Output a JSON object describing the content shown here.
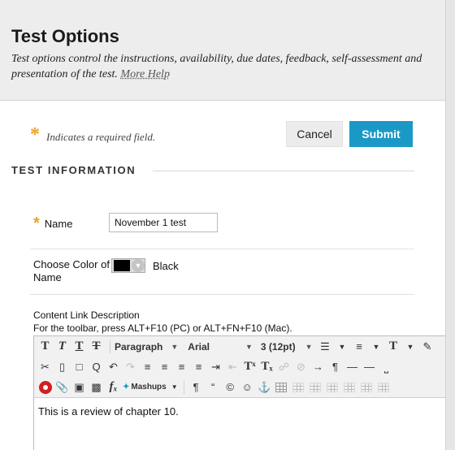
{
  "header": {
    "title": "Test Options",
    "description": "Test options control the instructions, availability, due dates, feedback, self-assessment and presentation of the test.",
    "help_link": "More Help"
  },
  "required_note": {
    "star": "*",
    "text": "Indicates a required field."
  },
  "actions": {
    "cancel_label": "Cancel",
    "submit_label": "Submit"
  },
  "section": {
    "title": "TEST INFORMATION"
  },
  "name_field": {
    "star": "*",
    "label": "Name",
    "value": "November 1 test"
  },
  "color_field": {
    "label": "Choose Color of Name",
    "swatch_color": "#000000",
    "value": "Black"
  },
  "content_link": {
    "label": "Content Link Description",
    "help": "For the toolbar, press ALT+F10 (PC) or ALT+FN+F10 (Mac)."
  },
  "editor": {
    "paragraph": "Paragraph",
    "font": "Arial",
    "size": "3 (12pt)",
    "mashups": "Mashups",
    "content": "This is a review of chapter 10."
  },
  "colors": {
    "accent": "#1a99c6",
    "required": "#f0a020",
    "header_bg": "#ededed"
  }
}
